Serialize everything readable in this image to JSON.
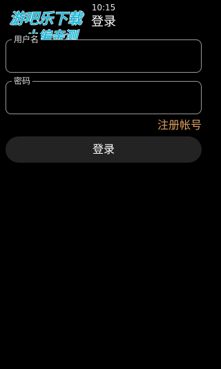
{
  "status_bar": {
    "time": "10:15"
  },
  "header": {
    "title": "登录"
  },
  "watermark": {
    "line1": "游吧乐下载",
    "line2": "小编亲测"
  },
  "form": {
    "username": {
      "label": "用户名",
      "value": ""
    },
    "password": {
      "label": "密码",
      "value": ""
    },
    "register_label": "注册帐号",
    "login_label": "登录"
  },
  "colors": {
    "background": "#000000",
    "field_border": "#9a9a9a",
    "register_link": "#e0a060",
    "button_bg": "#232323",
    "watermark_fill": "#1fb8d8"
  }
}
